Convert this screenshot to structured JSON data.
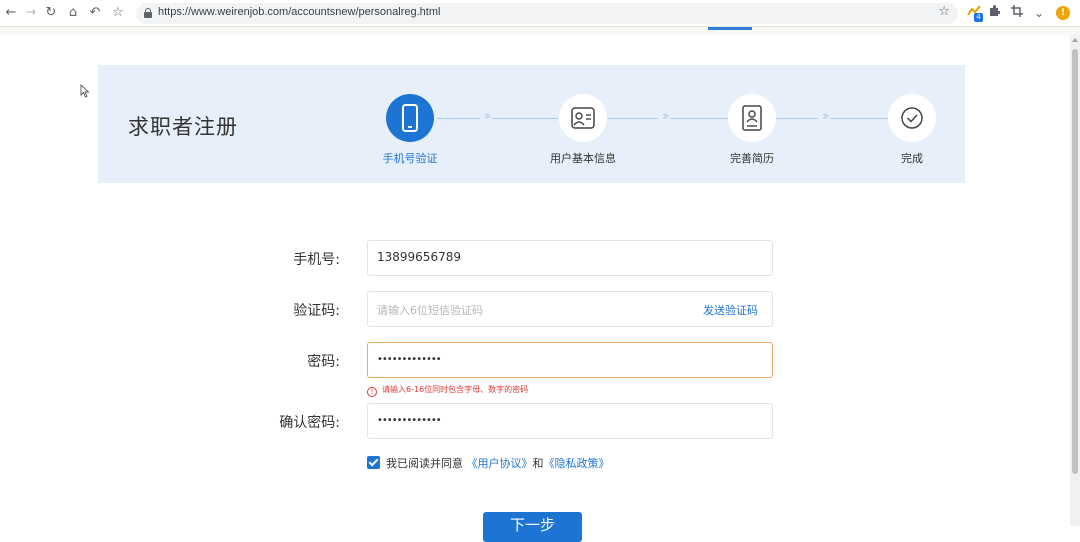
{
  "browser": {
    "url": "https://www.weirenjob.com/accountsnew/personalreg.html",
    "ext_badge": "4",
    "profile_initial": "!"
  },
  "banner": {
    "title": "求职者注册",
    "steps": [
      {
        "label": "手机号验证",
        "icon": "phone-icon",
        "active": true
      },
      {
        "label": "用户基本信息",
        "icon": "user-card-icon",
        "active": false
      },
      {
        "label": "完善简历",
        "icon": "resume-icon",
        "active": false
      },
      {
        "label": "完成",
        "icon": "check-circle-icon",
        "active": false
      }
    ]
  },
  "form": {
    "phone_label": "手机号:",
    "phone_value": "13899656789",
    "code_label": "验证码:",
    "code_placeholder": "请输入6位短信验证码",
    "send_code": "发送验证码",
    "password_label": "密码:",
    "password_value": "•••••••••••••",
    "password_error": "请输入6-16位同时包含字母、数字的密码",
    "confirm_label": "确认密码:",
    "confirm_value": "•••••••••••••",
    "agree_prefix": "我已阅读并同意",
    "user_agreement": "《用户协议》",
    "and": "和",
    "privacy_policy": "《隐私政策》",
    "next_button": "下一步"
  },
  "colors": {
    "primary": "#1e74d3",
    "banner_bg": "#e7f0fa",
    "error": "#e03a3a",
    "error_border": "#e9a96a"
  }
}
